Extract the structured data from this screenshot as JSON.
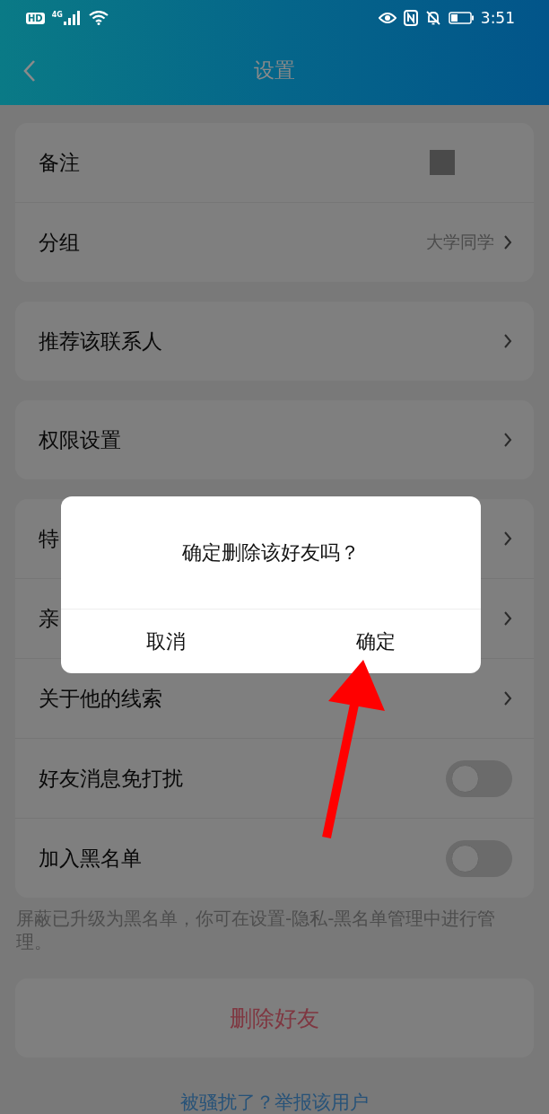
{
  "status_bar": {
    "hd": "HD",
    "network": "4G",
    "time": "3:51"
  },
  "header": {
    "title": "设置"
  },
  "groups": [
    {
      "rows": [
        {
          "kind": "masked",
          "label": "备注"
        },
        {
          "kind": "link",
          "label": "分组",
          "value": "大学同学"
        }
      ]
    },
    {
      "rows": [
        {
          "kind": "link",
          "label": "推荐该联系人"
        }
      ]
    },
    {
      "rows": [
        {
          "kind": "link",
          "label": "权限设置"
        }
      ]
    },
    {
      "rows": [
        {
          "kind": "link",
          "label": "特"
        },
        {
          "kind": "link",
          "label": "亲"
        },
        {
          "kind": "link",
          "label": "关于他的线索"
        },
        {
          "kind": "toggle",
          "label": "好友消息免打扰",
          "on": false
        },
        {
          "kind": "toggle",
          "label": "加入黑名单",
          "on": false
        }
      ]
    }
  ],
  "note": "屏蔽已升级为黑名单，你可在设置-隐私-黑名单管理中进行管理。",
  "delete_button": "删除好友",
  "report_link": "被骚扰了？举报该用户",
  "dialog": {
    "message": "确定删除该好友吗？",
    "buttons": [
      "取消",
      "确定"
    ]
  }
}
